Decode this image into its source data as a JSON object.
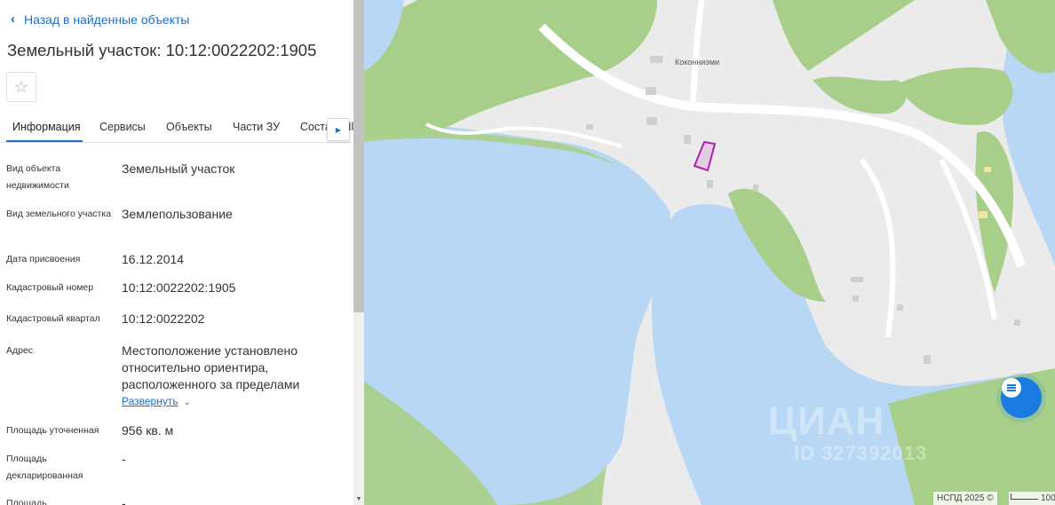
{
  "panel": {
    "back_label": "Назад в найденные объекты",
    "title": "Земельный участок: 10:12:0022202:1905",
    "tabs": [
      "Информация",
      "Сервисы",
      "Объекты",
      "Части ЗУ"
    ],
    "tab_partial": "Состав",
    "tab_tail": "Il",
    "details": [
      {
        "label": "Вид объекта недвижимости",
        "value": "Земельный участок"
      },
      {
        "label": "Вид земельного участка",
        "value": "Землепользование"
      },
      {
        "label": "Дата присвоения",
        "value": "16.12.2014"
      },
      {
        "label": "Кадастровый номер",
        "value": "10:12:0022202:1905"
      },
      {
        "label": "Кадастровый квартал",
        "value": "10:12:0022202"
      },
      {
        "label": "Адрес",
        "value": "Местоположение установлено относительно ориентира, расположенного за пределами"
      },
      {
        "label": "Площадь уточненная",
        "value": "956 кв. м"
      },
      {
        "label": "Площадь декларированная",
        "value": "-"
      },
      {
        "label": "Площадь",
        "value": "-"
      }
    ],
    "expand_label": "Развернуть"
  },
  "map": {
    "place_label": "Коконниэми",
    "watermark": "ЦИАН",
    "watermark_id": "ID 327392013",
    "attribution": "НСПД 2025 ©",
    "scale_label": "100",
    "colors": {
      "land": "#ebebeb",
      "water": "#b8d7f5",
      "forest": "#a8cf8a",
      "parcel": "#b020b0",
      "accent": "#1a7be0"
    }
  },
  "icons": [
    "chevron-left-icon",
    "star-icon",
    "chevron-right-icon",
    "chevron-down-icon",
    "chat-icon"
  ]
}
